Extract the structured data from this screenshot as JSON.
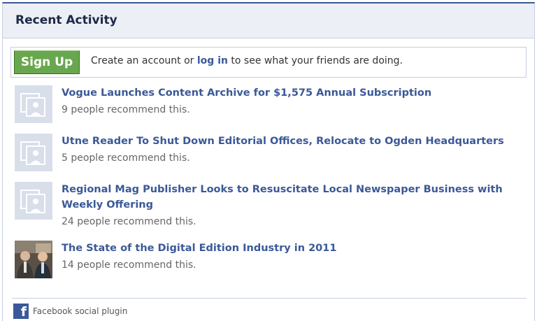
{
  "header": {
    "title": "Recent Activity"
  },
  "signup": {
    "button_label": "Sign Up",
    "text_before": "Create an account or ",
    "login_link": "log in",
    "text_after": " to see what your friends are doing."
  },
  "items": [
    {
      "title": "Vogue Launches Content Archive for $1,575 Annual Subscription",
      "meta": "9 people recommend this."
    },
    {
      "title": "Utne Reader To Shut Down Editorial Offices, Relocate to Ogden Headquarters",
      "meta": "5 people recommend this."
    },
    {
      "title": "Regional Mag Publisher Looks to Resuscitate Local Newspaper Business with Weekly Offering",
      "meta": "24 people recommend this."
    },
    {
      "title": "The State of the Digital Edition Industry in 2011",
      "meta": "14 people recommend this."
    }
  ],
  "footer": {
    "label": "Facebook social plugin"
  },
  "colors": {
    "brand": "#3b5998",
    "button": "#69a74e",
    "header_bg": "#eceff5"
  }
}
